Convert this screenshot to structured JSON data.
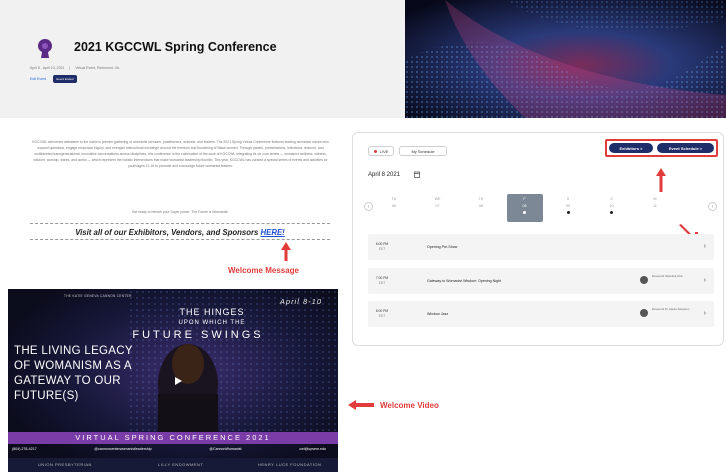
{
  "header": {
    "title": "2021 KGCCWL Spring Conference",
    "date_range": "April 8 - April 10, 2021",
    "location": "Virtual Event, Richmond, VA",
    "edit_link": "Edit Event",
    "status_badge": "Event Ended"
  },
  "welcome": {
    "paragraph": "KGCCWL welcomes attendees to the nation's premier gathering of womanist scholars, practitioners, activists, and leaders. The 2021 Spring Virtual Conference features leading womanist voices who expand questions, engage reciprocal inquiry, and energize intercultural exchange around the freedom and flourishing of Black women. Through panels, presentations, interviews, lectures, and multifaceted transgenerational, innovative conversations across disciplines, this conference is the culmination of the work of KGCCWL integrating its six core tenets — womanist wellness, witness, wisdom, worship, wares, and works — which represent the holistic intersections that make womanist leadership flourish. This year, KGCCWL has curated a special series of events and activities for youth/ages 12-18 to promote and encourage future womanist leaders.",
    "tagline": "Get ready to refresh your Super power. The Future is Womanist!",
    "visit_prefix": "Visit all of our Exhibitors, Vendors, and Sponsors ",
    "visit_link": "HERE!"
  },
  "annotations": {
    "welcome_message": "Welcome Message",
    "welcome_video": "Welcome Video"
  },
  "video": {
    "header_text": "THE KATIE GENEVA CANNON CENTER",
    "date": "April 8-10",
    "headline_1": "THE HINGES",
    "headline_2": "UPON WHICH THE",
    "headline_3": "FUTURE SWINGS",
    "body": "THE LIVING LEGACY OF WOMANISM AS A GATEWAY TO OUR FUTURE(S)",
    "conference": "VIRTUAL SPRING CONFERENCE 2021",
    "contacts": [
      "(804) 278-4217",
      "@cannoncenterwomanistleadership",
      "@CannonWomanist",
      "cwl@upsem.edu"
    ],
    "sponsors": [
      "UNION PRESBYTERIAN",
      "LILLY ENDOWMENT",
      "HENRY LUCE FOUNDATION"
    ]
  },
  "schedule": {
    "live_label": "LIVE",
    "my_schedule": "My Schedule",
    "exhibitors_btn": "Exhibitors >",
    "event_schedule_btn": "Event Schedule >",
    "current_date": "April 8 2021",
    "days": [
      {
        "dow": "TU",
        "num": "06",
        "has_events": false,
        "selected": false
      },
      {
        "dow": "WE",
        "num": "07",
        "has_events": false,
        "selected": false
      },
      {
        "dow": "TH",
        "num": "08",
        "has_events": false,
        "selected": false
      },
      {
        "dow": "F",
        "num": "08",
        "has_events": true,
        "selected": true
      },
      {
        "dow": "S",
        "num": "09",
        "has_events": true,
        "selected": false
      },
      {
        "dow": "S",
        "num": "10",
        "has_events": true,
        "selected": false
      },
      {
        "dow": "M",
        "num": "11",
        "has_events": false,
        "selected": false
      }
    ],
    "sessions": [
      {
        "time": "6:00 PM",
        "tz": "EDT",
        "name": "Opening Pre-Show",
        "speaker": ""
      },
      {
        "time": "7:00 PM",
        "tz": "EDT",
        "name": "Gateway to Womanist Wisdom: Opening Night",
        "speaker": "Reverend Valentina Ulric"
      },
      {
        "time": "8:00 PM",
        "tz": "EDT",
        "name": "Window Jazz",
        "speaker": "Reverend Dr. Alexia Sampson"
      }
    ]
  },
  "colors": {
    "accent_navy": "#1f2d6a",
    "annotation_red": "#e23b3b",
    "link_blue": "#1e4fd6",
    "video_purple": "#7a3ca6"
  }
}
